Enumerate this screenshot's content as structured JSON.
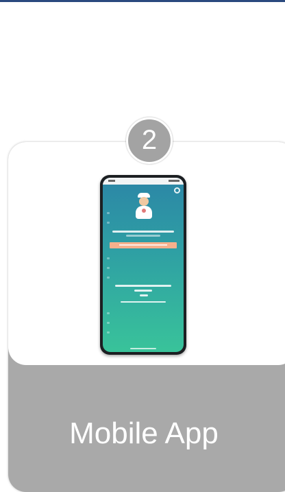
{
  "step": {
    "number": "2"
  },
  "card": {
    "title": "Mobile App"
  },
  "colors": {
    "top_bar": "#2b4a7e",
    "card_footer": "#a9a9a9",
    "badge": "#a3a3a3",
    "screen_top": "#2c86a6",
    "screen_bottom": "#39c39a",
    "highlight_bar": "#f6b08c"
  },
  "icons": {
    "settings": "gear-icon",
    "mascot": "doctor-avatar-icon"
  }
}
